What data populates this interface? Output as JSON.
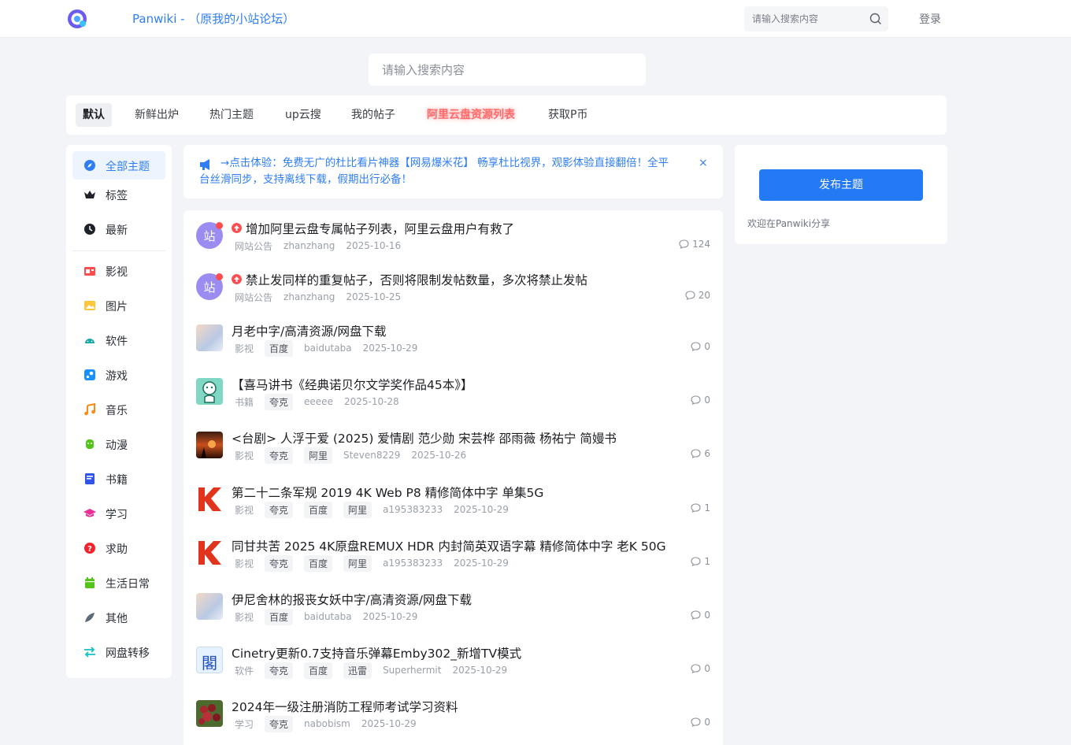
{
  "header": {
    "site_title": "Panwiki - （原我的小站论坛）",
    "search_placeholder": "请输入搜索内容",
    "login_label": "登录"
  },
  "main_search": {
    "placeholder": "请输入搜索内容"
  },
  "tabs": [
    {
      "label": "默认",
      "state": "active"
    },
    {
      "label": "新鲜出炉"
    },
    {
      "label": "热门主题"
    },
    {
      "label": "up云搜"
    },
    {
      "label": "我的帖子"
    },
    {
      "label": "阿里云盘资源列表",
      "state": "highlight"
    },
    {
      "label": "获取P币"
    }
  ],
  "sidebar": {
    "items": [
      {
        "label": "全部主题",
        "icon": "compass-icon",
        "active": true
      },
      {
        "label": "标签",
        "icon": "crown-icon"
      },
      {
        "label": "最新",
        "icon": "clock-icon"
      },
      {
        "label": "影视",
        "icon": "film-icon"
      },
      {
        "label": "图片",
        "icon": "image-icon"
      },
      {
        "label": "软件",
        "icon": "android-icon"
      },
      {
        "label": "游戏",
        "icon": "steam-icon"
      },
      {
        "label": "音乐",
        "icon": "music-icon"
      },
      {
        "label": "动漫",
        "icon": "anime-icon"
      },
      {
        "label": "书籍",
        "icon": "book-icon"
      },
      {
        "label": "学习",
        "icon": "graduation-cap-icon"
      },
      {
        "label": "求助",
        "icon": "question-icon"
      },
      {
        "label": "生活日常",
        "icon": "calendar-icon"
      },
      {
        "label": "其他",
        "icon": "feather-icon"
      },
      {
        "label": "网盘转移",
        "icon": "transfer-icon"
      }
    ]
  },
  "notice": {
    "text": "→点击体验：免费无广的杜比看片神器【网易爆米花】 畅享杜比视界，观影体验直接翻倍！全平台丝滑同步，支持离线下载，假期出行必备！",
    "close_label": "×"
  },
  "posts": [
    {
      "title": "增加阿里云盘专属帖子列表，阿里云盘用户有救了",
      "category": "网站公告",
      "tags": [],
      "author": "zhanzhang",
      "date": "2025-10-16",
      "comments": "124",
      "pinned": true,
      "avatar_text": "站",
      "avatar": "site"
    },
    {
      "title": "禁止发同样的重复帖子，否则将限制发帖数量，多次将禁止发帖",
      "category": "网站公告",
      "tags": [],
      "author": "zhanzhang",
      "date": "2025-10-25",
      "comments": "20",
      "pinned": true,
      "avatar_text": "站",
      "avatar": "site"
    },
    {
      "title": "月老中字/高清资源/网盘下载",
      "category": "影视",
      "tags": [
        "百度"
      ],
      "author": "baidutaba",
      "date": "2025-10-29",
      "comments": "0",
      "avatar": "anime"
    },
    {
      "title": "【喜马讲书《经典诺贝尔文学奖作品45本》】",
      "category": "书籍",
      "tags": [
        "夸克"
      ],
      "author": "eeeee",
      "date": "2025-10-28",
      "comments": "0",
      "avatar": "green"
    },
    {
      "title": "<台剧> 人浮于爱 (2025) 爱情剧 范少勋 宋芸桦 邵雨薇 杨祐宁 简嫚书",
      "category": "影视",
      "tags": [
        "夸克",
        "阿里"
      ],
      "author": "Steven8229",
      "date": "2025-10-26",
      "comments": "6",
      "avatar": "sunset"
    },
    {
      "title": "第二十二条军规 2019 4K Web P8 精修简体中字 单集5G",
      "category": "影视",
      "tags": [
        "夸克",
        "百度",
        "阿里"
      ],
      "author": "a195383233",
      "date": "2025-10-29",
      "comments": "1",
      "avatar": "k"
    },
    {
      "title": "同甘共苦 2025 4K原盘REMUX HDR 内封简英双语字幕 精修简体中字 老K 50G",
      "category": "影视",
      "tags": [
        "夸克",
        "百度",
        "阿里"
      ],
      "author": "a195383233",
      "date": "2025-10-29",
      "comments": "1",
      "avatar": "k"
    },
    {
      "title": "伊尼舍林的报丧女妖中字/高清资源/网盘下载",
      "category": "影视",
      "tags": [
        "百度"
      ],
      "author": "baidutaba",
      "date": "2025-10-29",
      "comments": "0",
      "avatar": "anime"
    },
    {
      "title": "Cinetry更新0.7支持音乐弹幕Emby302_新增TV模式",
      "category": "软件",
      "tags": [
        "夸克",
        "百度",
        "迅雷"
      ],
      "author": "Superhermit",
      "date": "2025-10-29",
      "comments": "0",
      "avatar": "kanji",
      "avatar_text": "閣"
    },
    {
      "title": "2024年一级注册消防工程师考试学习资料",
      "category": "学习",
      "tags": [
        "夸克"
      ],
      "author": "nabobism",
      "date": "2025-10-29",
      "comments": "0",
      "avatar": "berries"
    }
  ],
  "right_panel": {
    "publish_label": "发布主题",
    "welcome_text": "欢迎在Panwiki分享"
  },
  "colors": {
    "brand": "#2f7ef5",
    "publish": "#2479f5",
    "highlight": "#ff6b6b",
    "background": "#f3f4f8"
  }
}
